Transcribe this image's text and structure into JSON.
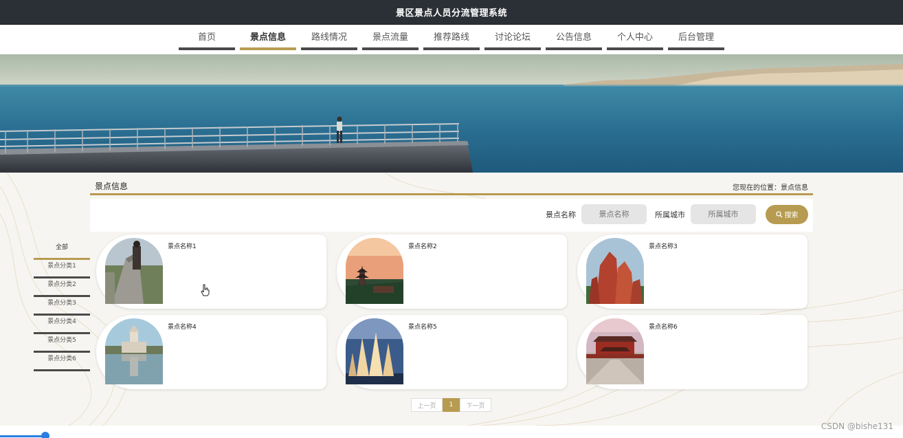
{
  "app": {
    "title": "景区景点人员分流管理系统"
  },
  "nav": [
    {
      "label": "首页"
    },
    {
      "label": "景点信息"
    },
    {
      "label": "路线情况"
    },
    {
      "label": "景点流量"
    },
    {
      "label": "推荐路线"
    },
    {
      "label": "讨论论坛"
    },
    {
      "label": "公告信息"
    },
    {
      "label": "个人中心"
    },
    {
      "label": "后台管理"
    }
  ],
  "nav_active": "景点信息",
  "section": {
    "title": "景点信息",
    "breadcrumb": "您现在的位置：景点信息"
  },
  "search": {
    "name_label": "景点名称",
    "name_placeholder": "景点名称",
    "city_label": "所属城市",
    "city_placeholder": "所属城市",
    "button_label": "搜索"
  },
  "categories": [
    {
      "label": "全部"
    },
    {
      "label": "景点分类1"
    },
    {
      "label": "景点分类2"
    },
    {
      "label": "景点分类3"
    },
    {
      "label": "景点分类4"
    },
    {
      "label": "景点分类5"
    },
    {
      "label": "景点分类6"
    }
  ],
  "spots": [
    {
      "name": "景点名称1",
      "image": "great-wall-photo"
    },
    {
      "name": "景点名称2",
      "image": "pagoda-sunset-photo"
    },
    {
      "name": "景点名称3",
      "image": "red-rocks-photo"
    },
    {
      "name": "景点名称4",
      "image": "memorial-reflection-photo"
    },
    {
      "name": "景点名称5",
      "image": "sail-towers-photo"
    },
    {
      "name": "景点名称6",
      "image": "palace-gate-photo"
    }
  ],
  "pagination": {
    "prev": "上一页",
    "current": "1",
    "next": "下一页"
  },
  "watermark": "CSDN @bishe131",
  "colors": {
    "accent": "#b79b50",
    "topbar": "#2b2f36",
    "nav_underline": "#4a4a4a"
  }
}
